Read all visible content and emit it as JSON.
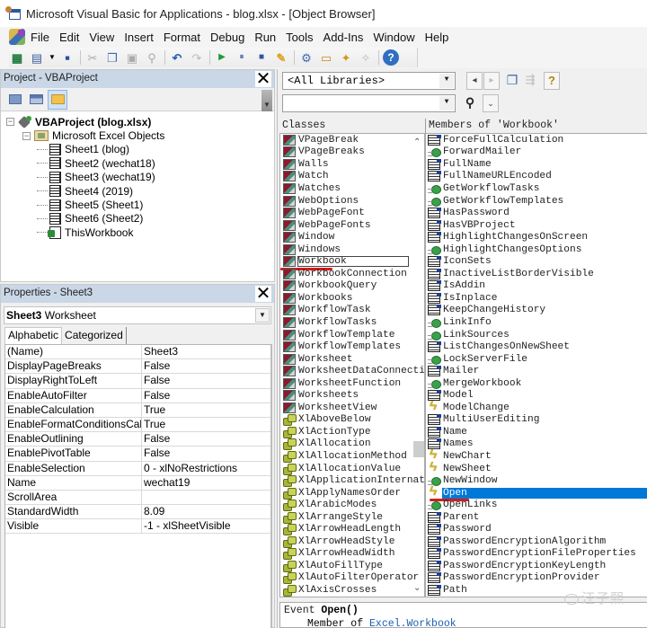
{
  "window": {
    "title": "Microsoft Visual Basic for Applications - blog.xlsx - [Object Browser]"
  },
  "menu": {
    "items": [
      {
        "label": "File",
        "icon": null
      },
      {
        "label": "Edit"
      },
      {
        "label": "View"
      },
      {
        "label": "Insert"
      },
      {
        "label": "Format"
      },
      {
        "label": "Debug"
      },
      {
        "label": "Run"
      },
      {
        "label": "Tools"
      },
      {
        "label": "Add-Ins"
      },
      {
        "label": "Window"
      },
      {
        "label": "Help"
      }
    ]
  },
  "toolbar": {
    "buttons": [
      "view-excel",
      "insert-userform",
      "save",
      "cut",
      "copy",
      "paste",
      "find",
      "undo",
      "redo",
      "run",
      "break",
      "reset",
      "design-mode",
      "project-explorer",
      "properties-window",
      "object-browser",
      "toolbox",
      "help"
    ],
    "glyphs": {
      "view-excel": "▦",
      "insert-userform": "▤",
      "save": "▪",
      "cut": "✂",
      "copy": "❐",
      "paste": "▣",
      "find": "⚲",
      "undo": "↶",
      "redo": "↷",
      "run": "▶",
      "break": "⏸",
      "reset": "■",
      "design-mode": "✎",
      "project-explorer": "⚙",
      "properties-window": "▭",
      "object-browser": "✦",
      "toolbox": "✧",
      "help": "?"
    }
  },
  "project_pane": {
    "title": "Project - VBAProject",
    "close": "✕",
    "tree": [
      {
        "label": "VBAProject (blog.xlsx)",
        "level": 0,
        "icon": "vbaproject-icon",
        "bold": true,
        "expander": "−"
      },
      {
        "label": "Microsoft Excel Objects",
        "level": 1,
        "icon": "folder-icon",
        "expander": "−"
      },
      {
        "label": "Sheet1 (blog)",
        "level": 2,
        "icon": "sheet-icon"
      },
      {
        "label": "Sheet2 (wechat18)",
        "level": 2,
        "icon": "sheet-icon"
      },
      {
        "label": "Sheet3 (wechat19)",
        "level": 2,
        "icon": "sheet-icon"
      },
      {
        "label": "Sheet4 (2019)",
        "level": 2,
        "icon": "sheet-icon"
      },
      {
        "label": "Sheet5 (Sheet1)",
        "level": 2,
        "icon": "sheet-icon"
      },
      {
        "label": "Sheet6 (Sheet2)",
        "level": 2,
        "icon": "sheet-icon"
      },
      {
        "label": "ThisWorkbook",
        "level": 2,
        "icon": "workbook-icon"
      }
    ]
  },
  "properties_pane": {
    "title": "Properties - Sheet3",
    "close": "✕",
    "object_name": "Sheet3",
    "object_type": "Worksheet",
    "tabs": [
      "Alphabetic",
      "Categorized"
    ],
    "active_tab": "Alphabetic",
    "rows": [
      {
        "name": "(Name)",
        "value": "Sheet3"
      },
      {
        "name": "DisplayPageBreaks",
        "value": "False"
      },
      {
        "name": "DisplayRightToLeft",
        "value": "False"
      },
      {
        "name": "EnableAutoFilter",
        "value": "False"
      },
      {
        "name": "EnableCalculation",
        "value": "True"
      },
      {
        "name": "EnableFormatConditionsCalculation",
        "value": "True"
      },
      {
        "name": "EnableOutlining",
        "value": "False"
      },
      {
        "name": "EnablePivotTable",
        "value": "False"
      },
      {
        "name": "EnableSelection",
        "value": "0 - xlNoRestrictions"
      },
      {
        "name": "Name",
        "value": "wechat19"
      },
      {
        "name": "ScrollArea",
        "value": ""
      },
      {
        "name": "StandardWidth",
        "value": "8.09"
      },
      {
        "name": "Visible",
        "value": "-1 - xlSheetVisible"
      }
    ]
  },
  "object_browser": {
    "library_combo": "<All Libraries>",
    "search_combo": "",
    "classes_header": "Classes",
    "members_header": "Members of 'Workbook'",
    "classes": [
      {
        "label": "VPageBreak",
        "kind": "class"
      },
      {
        "label": "VPageBreaks",
        "kind": "class"
      },
      {
        "label": "Walls",
        "kind": "class"
      },
      {
        "label": "Watch",
        "kind": "class"
      },
      {
        "label": "Watches",
        "kind": "class"
      },
      {
        "label": "WebOptions",
        "kind": "class"
      },
      {
        "label": "WebPageFont",
        "kind": "class"
      },
      {
        "label": "WebPageFonts",
        "kind": "class"
      },
      {
        "label": "Window",
        "kind": "class"
      },
      {
        "label": "Windows",
        "kind": "class"
      },
      {
        "label": "Workbook",
        "kind": "class",
        "focused": true
      },
      {
        "label": "WorkbookConnection",
        "kind": "class"
      },
      {
        "label": "WorkbookQuery",
        "kind": "class"
      },
      {
        "label": "Workbooks",
        "kind": "class"
      },
      {
        "label": "WorkflowTask",
        "kind": "class"
      },
      {
        "label": "WorkflowTasks",
        "kind": "class"
      },
      {
        "label": "WorkflowTemplate",
        "kind": "class"
      },
      {
        "label": "WorkflowTemplates",
        "kind": "class"
      },
      {
        "label": "Worksheet",
        "kind": "class"
      },
      {
        "label": "WorksheetDataConnecti",
        "kind": "class"
      },
      {
        "label": "WorksheetFunction",
        "kind": "class"
      },
      {
        "label": "Worksheets",
        "kind": "class"
      },
      {
        "label": "WorksheetView",
        "kind": "class"
      },
      {
        "label": "XlAboveBelow",
        "kind": "enum"
      },
      {
        "label": "XlActionType",
        "kind": "enum"
      },
      {
        "label": "XlAllocation",
        "kind": "enum"
      },
      {
        "label": "XlAllocationMethod",
        "kind": "enum"
      },
      {
        "label": "XlAllocationValue",
        "kind": "enum"
      },
      {
        "label": "XlApplicationInternat",
        "kind": "enum"
      },
      {
        "label": "XlApplyNamesOrder",
        "kind": "enum"
      },
      {
        "label": "XlArabicModes",
        "kind": "enum"
      },
      {
        "label": "XlArrangeStyle",
        "kind": "enum"
      },
      {
        "label": "XlArrowHeadLength",
        "kind": "enum"
      },
      {
        "label": "XlArrowHeadStyle",
        "kind": "enum"
      },
      {
        "label": "XlArrowHeadWidth",
        "kind": "enum"
      },
      {
        "label": "XlAutoFillType",
        "kind": "enum"
      },
      {
        "label": "XlAutoFilterOperator",
        "kind": "enum"
      },
      {
        "label": "XlAxisCrosses",
        "kind": "enum"
      }
    ],
    "members": [
      {
        "label": "ForceFullCalculation",
        "kind": "property"
      },
      {
        "label": "ForwardMailer",
        "kind": "method"
      },
      {
        "label": "FullName",
        "kind": "property"
      },
      {
        "label": "FullNameURLEncoded",
        "kind": "property"
      },
      {
        "label": "GetWorkflowTasks",
        "kind": "method"
      },
      {
        "label": "GetWorkflowTemplates",
        "kind": "method"
      },
      {
        "label": "HasPassword",
        "kind": "property"
      },
      {
        "label": "HasVBProject",
        "kind": "property"
      },
      {
        "label": "HighlightChangesOnScreen",
        "kind": "property"
      },
      {
        "label": "HighlightChangesOptions",
        "kind": "method"
      },
      {
        "label": "IconSets",
        "kind": "property"
      },
      {
        "label": "InactiveListBorderVisible",
        "kind": "property"
      },
      {
        "label": "IsAddin",
        "kind": "property"
      },
      {
        "label": "IsInplace",
        "kind": "property"
      },
      {
        "label": "KeepChangeHistory",
        "kind": "property"
      },
      {
        "label": "LinkInfo",
        "kind": "method"
      },
      {
        "label": "LinkSources",
        "kind": "method"
      },
      {
        "label": "ListChangesOnNewSheet",
        "kind": "property"
      },
      {
        "label": "LockServerFile",
        "kind": "method"
      },
      {
        "label": "Mailer",
        "kind": "property"
      },
      {
        "label": "MergeWorkbook",
        "kind": "method"
      },
      {
        "label": "Model",
        "kind": "property"
      },
      {
        "label": "ModelChange",
        "kind": "event"
      },
      {
        "label": "MultiUserEditing",
        "kind": "property"
      },
      {
        "label": "Name",
        "kind": "property"
      },
      {
        "label": "Names",
        "kind": "property"
      },
      {
        "label": "NewChart",
        "kind": "event"
      },
      {
        "label": "NewSheet",
        "kind": "event"
      },
      {
        "label": "NewWindow",
        "kind": "method"
      },
      {
        "label": "Open",
        "kind": "event",
        "selected": true
      },
      {
        "label": "OpenLinks",
        "kind": "method"
      },
      {
        "label": "Parent",
        "kind": "property"
      },
      {
        "label": "Password",
        "kind": "property"
      },
      {
        "label": "PasswordEncryptionAlgorithm",
        "kind": "property"
      },
      {
        "label": "PasswordEncryptionFileProperties",
        "kind": "property"
      },
      {
        "label": "PasswordEncryptionKeyLength",
        "kind": "property"
      },
      {
        "label": "PasswordEncryptionProvider",
        "kind": "property"
      },
      {
        "label": "Path",
        "kind": "property"
      }
    ],
    "description": {
      "kind": "Event",
      "signature": "Open()",
      "member_of_label": "Member of",
      "member_of_link": "Excel.Workbook"
    }
  },
  "watermark": "汪子熙",
  "colors": {
    "selection": "#0078d7",
    "pane_title_bg": "#c9d7e6",
    "annotation_underline": "#d21d1d",
    "link": "#1a5fb4"
  }
}
